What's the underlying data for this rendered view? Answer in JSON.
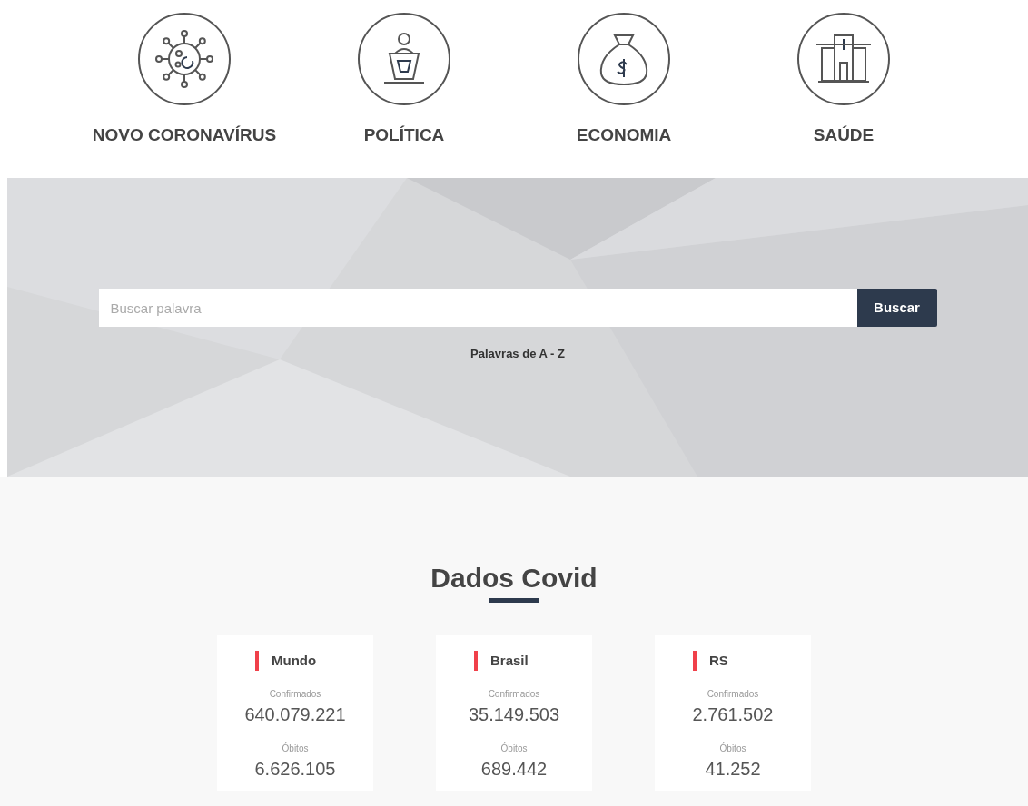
{
  "categories": [
    {
      "kind": "virus",
      "label": "NOVO CORONAVÍRUS"
    },
    {
      "kind": "podium",
      "label": "POLÍTICA"
    },
    {
      "kind": "moneybag",
      "label": "ECONOMIA"
    },
    {
      "kind": "hospital",
      "label": "SAÚDE"
    }
  ],
  "search": {
    "placeholder": "Buscar palavra",
    "button": "Buscar",
    "link": "Palavras de A - Z"
  },
  "covid": {
    "title": "Dados Covid",
    "cards": [
      {
        "region": "Mundo",
        "confirmed_label": "Confirmados",
        "confirmed": "640.079.221",
        "deaths_label": "Óbitos",
        "deaths": "6.626.105"
      },
      {
        "region": "Brasil",
        "confirmed_label": "Confirmados",
        "confirmed": "35.149.503",
        "deaths_label": "Óbitos",
        "deaths": "689.442"
      },
      {
        "region": "RS",
        "confirmed_label": "Confirmados",
        "confirmed": "2.761.502",
        "deaths_label": "Óbitos",
        "deaths": "41.252"
      }
    ]
  }
}
